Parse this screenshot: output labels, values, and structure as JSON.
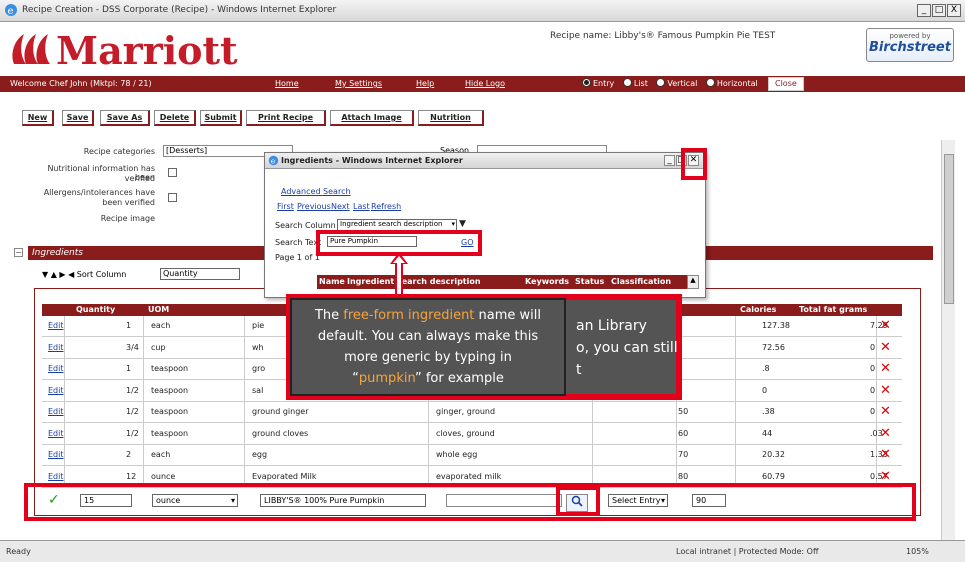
{
  "window": {
    "title": "Recipe Creation - DSS Corporate (Recipe) - Windows Internet Explorer",
    "buttons": [
      "_",
      "□",
      "X"
    ]
  },
  "header": {
    "brand": "Marriott",
    "recipe_name": "Recipe name: Libby's® Famous Pumpkin Pie TEST",
    "partner_small": "powered by",
    "partner_name": "Birchstreet"
  },
  "menubar": {
    "welcome": "Welcome Chef John (Mktpl: 78 / 21)",
    "links": [
      "Home",
      "My Settings",
      "Help",
      "Hide Logo"
    ],
    "radios": [
      {
        "label": "Entry",
        "selected": true
      },
      {
        "label": "List",
        "selected": false
      },
      {
        "label": "Vertical",
        "selected": false
      },
      {
        "label": "Horizontal",
        "selected": false
      }
    ],
    "close": "Close"
  },
  "toolbar": {
    "buttons": [
      "New",
      "Save",
      "Save As",
      "Delete",
      "Submit",
      "Print Recipe",
      "Attach Image",
      "Nutrition"
    ]
  },
  "form": {
    "recipe_categories_label": "Recipe categories",
    "recipe_categories_value": "[Desserts]",
    "nutritional_label_1": "Nutritional information has been",
    "nutritional_label_2": "verified",
    "allergens_label_1": "Allergens/intolerances have",
    "allergens_label_2": "been verified",
    "recipe_image_label": "Recipe image",
    "season_label": "Season"
  },
  "ingredients": {
    "section_title": "Ingredients",
    "sort_label": "▼ ▲ ▶ ◀  Sort Column",
    "sort_value": "Quantity",
    "columns": [
      "Quantity",
      "UOM",
      "Calories",
      "Total fat grams"
    ],
    "rows": [
      {
        "edit": "Edit",
        "qty": "1",
        "uom": "each",
        "ing": "pie",
        "match": "",
        "p": "",
        "cal": "127.38",
        "fat": "7.29"
      },
      {
        "edit": "Edit",
        "qty": "3/4",
        "uom": "cup",
        "ing": "wh",
        "match": "",
        "p": "",
        "cal": "72.56",
        "fat": "0"
      },
      {
        "edit": "Edit",
        "qty": "1",
        "uom": "teaspoon",
        "ing": "gro",
        "match": "",
        "p": "",
        "cal": ".8",
        "fat": "0"
      },
      {
        "edit": "Edit",
        "qty": "1/2",
        "uom": "teaspoon",
        "ing": "sal",
        "match": "",
        "p": "",
        "cal": "0",
        "fat": "0"
      },
      {
        "edit": "Edit",
        "qty": "1/2",
        "uom": "teaspoon",
        "ing": "ground ginger",
        "match": "ginger, ground",
        "p": "50",
        "cal": ".38",
        "fat": "0"
      },
      {
        "edit": "Edit",
        "qty": "1/2",
        "uom": "teaspoon",
        "ing": "ground cloves",
        "match": "cloves, ground",
        "p": "60",
        "cal": "44",
        "fat": ".03"
      },
      {
        "edit": "Edit",
        "qty": "2",
        "uom": "each",
        "ing": "egg",
        "match": "whole egg",
        "p": "70",
        "cal": "20.32",
        "fat": "1.33"
      },
      {
        "edit": "Edit",
        "qty": "12",
        "uom": "ounce",
        "ing": "Evaporated Milk",
        "match": "evaporated milk",
        "p": "80",
        "cal": "60.79",
        "fat": "0.57"
      }
    ],
    "entry": {
      "qty": "15",
      "uom": "ounce",
      "ingredient": "LIBBY'S® 100% Pure Pumpkin",
      "search_value": "",
      "select_label": "Select Entry",
      "position": "90"
    }
  },
  "popup": {
    "title": "Ingredients - Windows Internet Explorer",
    "advanced_search": "Advanced Search",
    "nav": [
      "First",
      "Previous",
      "Next",
      "Last",
      "Refresh"
    ],
    "search_column_label": "Search Column",
    "search_column_value": "Ingredient search description",
    "search_text_label": "Search Text",
    "search_text_value": "Pure Pumpkin",
    "go": "GO",
    "page_label": "Page 1 of 1",
    "columns": [
      "Name",
      "Ingredient search description",
      "Keywords",
      "Status",
      "Classification"
    ]
  },
  "callout": {
    "back_lines": [
      "an Library",
      "o, you can still",
      "t"
    ],
    "front_line1_pre": "The ",
    "front_line1_accent": "free-form ingredient",
    "front_line1_post": " name will",
    "front_line2": "default. You can always make this",
    "front_line3": "more generic by typing in",
    "front_line4_pre": "“",
    "front_line4_accent": "pumpkin",
    "front_line4_post": "” for example"
  },
  "statusbar": {
    "left": "Ready",
    "zone": "Local intranet | Protected Mode: Off",
    "zoom": "105%"
  },
  "colors": {
    "brand": "#8a1c1c",
    "highlight": "#e3001b",
    "callout_bg": "#545454",
    "accent": "#f7a53b"
  }
}
